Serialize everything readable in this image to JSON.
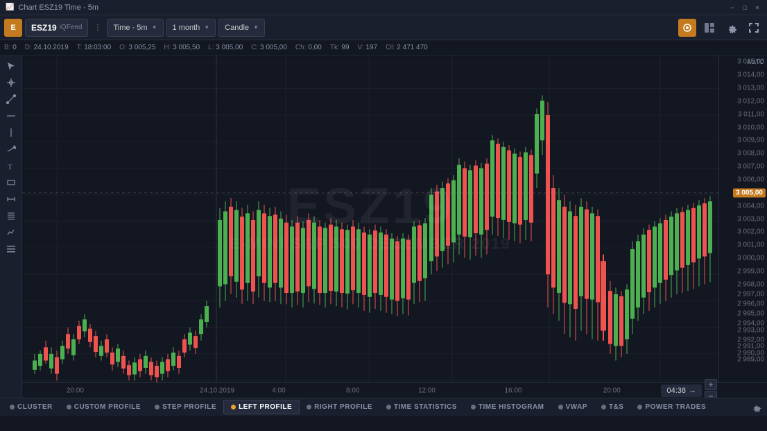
{
  "titleBar": {
    "title": "Chart ESZ19 Time - 5m",
    "minimize": "−",
    "maximize": "□",
    "close": "×"
  },
  "toolbar": {
    "symbol": "ESZ19",
    "feed": "iQFeed",
    "timeframe": "Time - 5m",
    "range": "1 month",
    "chartType": "Candle",
    "icons": {
      "watch": "👁",
      "layout": "⊞",
      "settings": "⚙",
      "fullscreen": "⤢"
    }
  },
  "dataBar": {
    "b_label": "B:",
    "b_val": "0",
    "d_label": "D:",
    "d_val": "24.10.2019",
    "t_label": "T:",
    "t_val": "18:03:00",
    "o_label": "O:",
    "o_val": "3 005,25",
    "h_label": "H:",
    "h_val": "3 005,50",
    "l_label": "L:",
    "l_val": "3 005,00",
    "c_label": "C:",
    "c_val": "3 005,00",
    "ch_label": "Ch:",
    "ch_val": "0,00",
    "tk_label": "Tk:",
    "tk_val": "99",
    "v_label": "V:",
    "v_val": "197",
    "oi_label": "OI:",
    "oi_val": "2 471 470"
  },
  "priceAxis": {
    "auto": "AUTO",
    "prices": [
      {
        "value": "3 015,00",
        "pct": 2
      },
      {
        "value": "3 014,00",
        "pct": 6
      },
      {
        "value": "3 013,00",
        "pct": 10
      },
      {
        "value": "3 012,00",
        "pct": 14
      },
      {
        "value": "3 011,00",
        "pct": 18
      },
      {
        "value": "3 010,00",
        "pct": 22
      },
      {
        "value": "3 009,00",
        "pct": 26
      },
      {
        "value": "3 008,00",
        "pct": 30
      },
      {
        "value": "3 007,00",
        "pct": 34
      },
      {
        "value": "3 006,00",
        "pct": 38
      },
      {
        "value": "3 005,00",
        "pct": 42,
        "current": true
      },
      {
        "value": "3 004,00",
        "pct": 46
      },
      {
        "value": "3 003,00",
        "pct": 50
      },
      {
        "value": "3 002,00",
        "pct": 54
      },
      {
        "value": "3 001,00",
        "pct": 58
      },
      {
        "value": "3 000,00",
        "pct": 62
      },
      {
        "value": "2 999,00",
        "pct": 66
      },
      {
        "value": "2 998,00",
        "pct": 70
      },
      {
        "value": "2 997,00",
        "pct": 73
      },
      {
        "value": "2 996,00",
        "pct": 76
      },
      {
        "value": "2 995,00",
        "pct": 79
      },
      {
        "value": "2 994,00",
        "pct": 82
      },
      {
        "value": "2 993,00",
        "pct": 84
      },
      {
        "value": "2 992,00",
        "pct": 87
      },
      {
        "value": "2 991,00",
        "pct": 89
      },
      {
        "value": "2 990,00",
        "pct": 91
      },
      {
        "value": "2 989,00",
        "pct": 93
      }
    ]
  },
  "timeAxis": {
    "labels": [
      {
        "text": "20:00",
        "pct": 5
      },
      {
        "text": "24.10.2019",
        "pct": 28
      },
      {
        "text": "4:00",
        "pct": 38
      },
      {
        "text": "8:00",
        "pct": 50
      },
      {
        "text": "12:00",
        "pct": 62
      },
      {
        "text": "16:00",
        "pct": 76
      },
      {
        "text": "20:00",
        "pct": 92
      }
    ]
  },
  "watermark": {
    "symbol": "ESZ19",
    "name": "E-MINI S&P 500 DECEMBER 2019"
  },
  "clock": {
    "time": "04:38",
    "arrow": "→"
  },
  "bottomTabs": [
    {
      "label": "CLUSTER",
      "dotColor": "#6a6e7e",
      "active": false
    },
    {
      "label": "CUSTOM PROFILE",
      "dotColor": "#6a6e7e",
      "active": false
    },
    {
      "label": "STEP PROFILE",
      "dotColor": "#6a6e7e",
      "active": false
    },
    {
      "label": "LEFT PROFILE",
      "dotColor": "#e8a030",
      "active": true
    },
    {
      "label": "RIGHT PROFILE",
      "dotColor": "#6a6e7e",
      "active": false
    },
    {
      "label": "TIME STATISTICS",
      "dotColor": "#6a6e7e",
      "active": false
    },
    {
      "label": "TIME HISTOGRAM",
      "dotColor": "#6a6e7e",
      "active": false
    },
    {
      "label": "VWAP",
      "dotColor": "#6a6e7e",
      "active": false
    },
    {
      "label": "T&S",
      "dotColor": "#6a6e7e",
      "active": false
    },
    {
      "label": "POWER TRADES",
      "dotColor": "#6a6e7e",
      "active": false
    }
  ],
  "leftTools": [
    {
      "icon": "⊕",
      "name": "add-tool"
    },
    {
      "icon": "↖",
      "name": "cursor-tool"
    },
    {
      "icon": "✎",
      "name": "draw-tool"
    },
    {
      "icon": "∿",
      "name": "wave-tool"
    },
    {
      "icon": "╱",
      "name": "line-tool"
    },
    {
      "icon": "⊸",
      "name": "arrow-tool"
    },
    {
      "icon": "⌒",
      "name": "arc-tool"
    },
    {
      "icon": "☰",
      "name": "text-tool"
    },
    {
      "icon": "⬜",
      "name": "rect-tool"
    },
    {
      "icon": "⊡",
      "name": "box-tool"
    },
    {
      "icon": "✦",
      "name": "star-tool"
    },
    {
      "icon": "≡",
      "name": "list-tool"
    }
  ]
}
